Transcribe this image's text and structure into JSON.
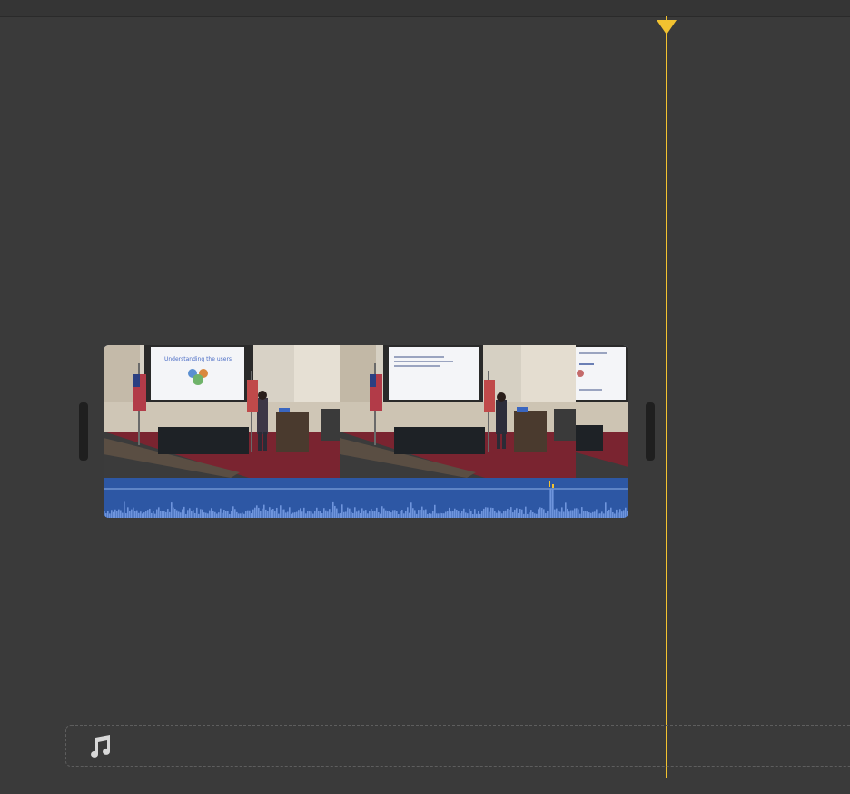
{
  "app": {
    "view": "timeline"
  },
  "clip": {
    "thumbnails": [
      {
        "slide_title": "Understanding the users"
      },
      {
        "slide_title": ""
      },
      {
        "slide_title": ""
      }
    ],
    "audio_color": "#2d57a4"
  },
  "playhead": {
    "color": "#f2c230"
  },
  "music_track": {
    "icon": "music-note-icon"
  }
}
